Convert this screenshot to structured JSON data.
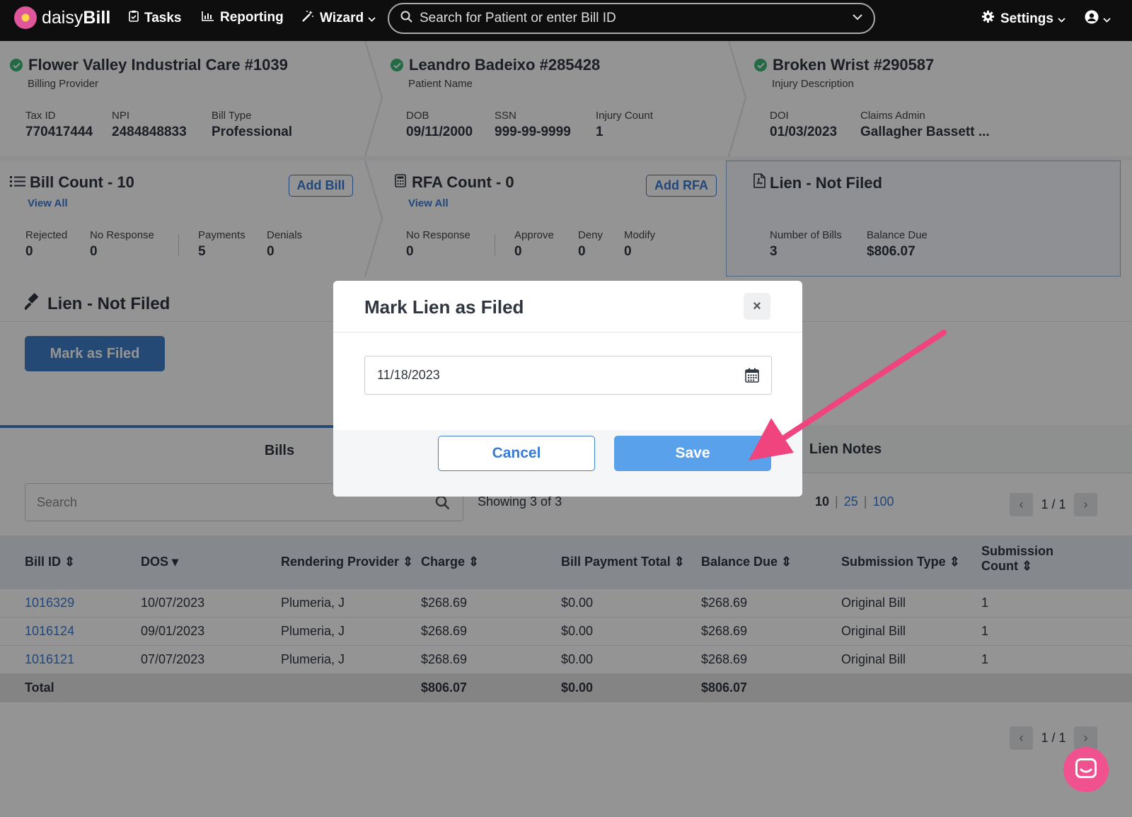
{
  "nav": {
    "logo_prefix": "daisy",
    "logo_suffix": "Bill",
    "tasks": "Tasks",
    "reporting": "Reporting",
    "wizard": "Wizard",
    "search_placeholder": "Search for Patient or enter Bill ID",
    "settings": "Settings"
  },
  "provider": {
    "title": "Flower Valley Industrial Care #1039",
    "subtitle": "Billing Provider",
    "fields": [
      {
        "label": "Tax ID",
        "value": "770417444"
      },
      {
        "label": "NPI",
        "value": "2484848833"
      },
      {
        "label": "Bill Type",
        "value": "Professional"
      }
    ]
  },
  "patient": {
    "title": "Leandro Badeixo #285428",
    "subtitle": "Patient Name",
    "fields": [
      {
        "label": "DOB",
        "value": "09/11/2000"
      },
      {
        "label": "SSN",
        "value": "999-99-9999"
      },
      {
        "label": "Injury Count",
        "value": "1"
      }
    ]
  },
  "injury": {
    "title": "Broken Wrist #290587",
    "subtitle": "Injury Description",
    "fields": [
      {
        "label": "DOI",
        "value": "01/03/2023"
      },
      {
        "label": "Claims Admin",
        "value": "Gallagher Bassett ..."
      }
    ]
  },
  "bill_count": {
    "title": "Bill Count - 10",
    "view_all": "View All",
    "add_label": "Add Bill",
    "stats": [
      {
        "label": "Rejected",
        "value": "0"
      },
      {
        "label": "No Response",
        "value": "0"
      },
      {
        "label": "Payments",
        "value": "5"
      },
      {
        "label": "Denials",
        "value": "0"
      }
    ]
  },
  "rfa_count": {
    "title": "RFA Count - 0",
    "view_all": "View All",
    "add_label": "Add RFA",
    "stats": [
      {
        "label": "No Response",
        "value": "0"
      },
      {
        "label": "Approve",
        "value": "0"
      },
      {
        "label": "Deny",
        "value": "0"
      },
      {
        "label": "Modify",
        "value": "0"
      }
    ]
  },
  "lien_card": {
    "title": "Lien - Not Filed",
    "stats": [
      {
        "label": "Number of Bills",
        "value": "3"
      },
      {
        "label": "Balance Due",
        "value": "$806.07"
      }
    ]
  },
  "lien_section": {
    "title": "Lien - Not Filed",
    "mark_button": "Mark as Filed"
  },
  "tabs": [
    {
      "label": "Bills",
      "active": true
    },
    {
      "label": "Lien Notes",
      "active": false
    }
  ],
  "table": {
    "search_placeholder": "Search",
    "showing": "Showing 3 of 3",
    "page_sizes": [
      "10",
      "25",
      "100"
    ],
    "page": "1 / 1",
    "columns": [
      "Bill ID",
      "DOS",
      "Rendering Provider",
      "Charge",
      "Bill Payment Total",
      "Balance Due",
      "Submission Type",
      "Submission",
      "Count"
    ],
    "rows": [
      [
        "1016329",
        "10/07/2023",
        "Plumeria, J",
        "$268.69",
        "$0.00",
        "$268.69",
        "Original Bill",
        "1"
      ],
      [
        "1016124",
        "09/01/2023",
        "Plumeria, J",
        "$268.69",
        "$0.00",
        "$268.69",
        "Original Bill",
        "1"
      ],
      [
        "1016121",
        "07/07/2023",
        "Plumeria, J",
        "$268.69",
        "$0.00",
        "$268.69",
        "Original Bill",
        "1"
      ]
    ],
    "total": {
      "label": "Total",
      "charge": "$806.07",
      "payment": "$0.00",
      "balance": "$806.07"
    }
  },
  "modal": {
    "title": "Mark Lien as Filed",
    "date_value": "11/18/2023",
    "cancel": "Cancel",
    "save": "Save",
    "close_symbol": "×"
  },
  "colors": {
    "accent": "#3f7fc8",
    "save": "#5aa1ec",
    "annotation_arrow": "#f0447f",
    "check_green": "#3cb878"
  },
  "icons": [
    "logo-flower-icon",
    "clipboard-icon",
    "bar-chart-icon",
    "magic-wand-icon",
    "search-icon",
    "chevron-down-icon",
    "gear-icon",
    "user-circle-icon",
    "check-circle-icon",
    "list-icon",
    "calculator-icon",
    "pdf-file-icon",
    "gavel-icon",
    "calendar-icon",
    "close-icon",
    "chat-icon"
  ]
}
